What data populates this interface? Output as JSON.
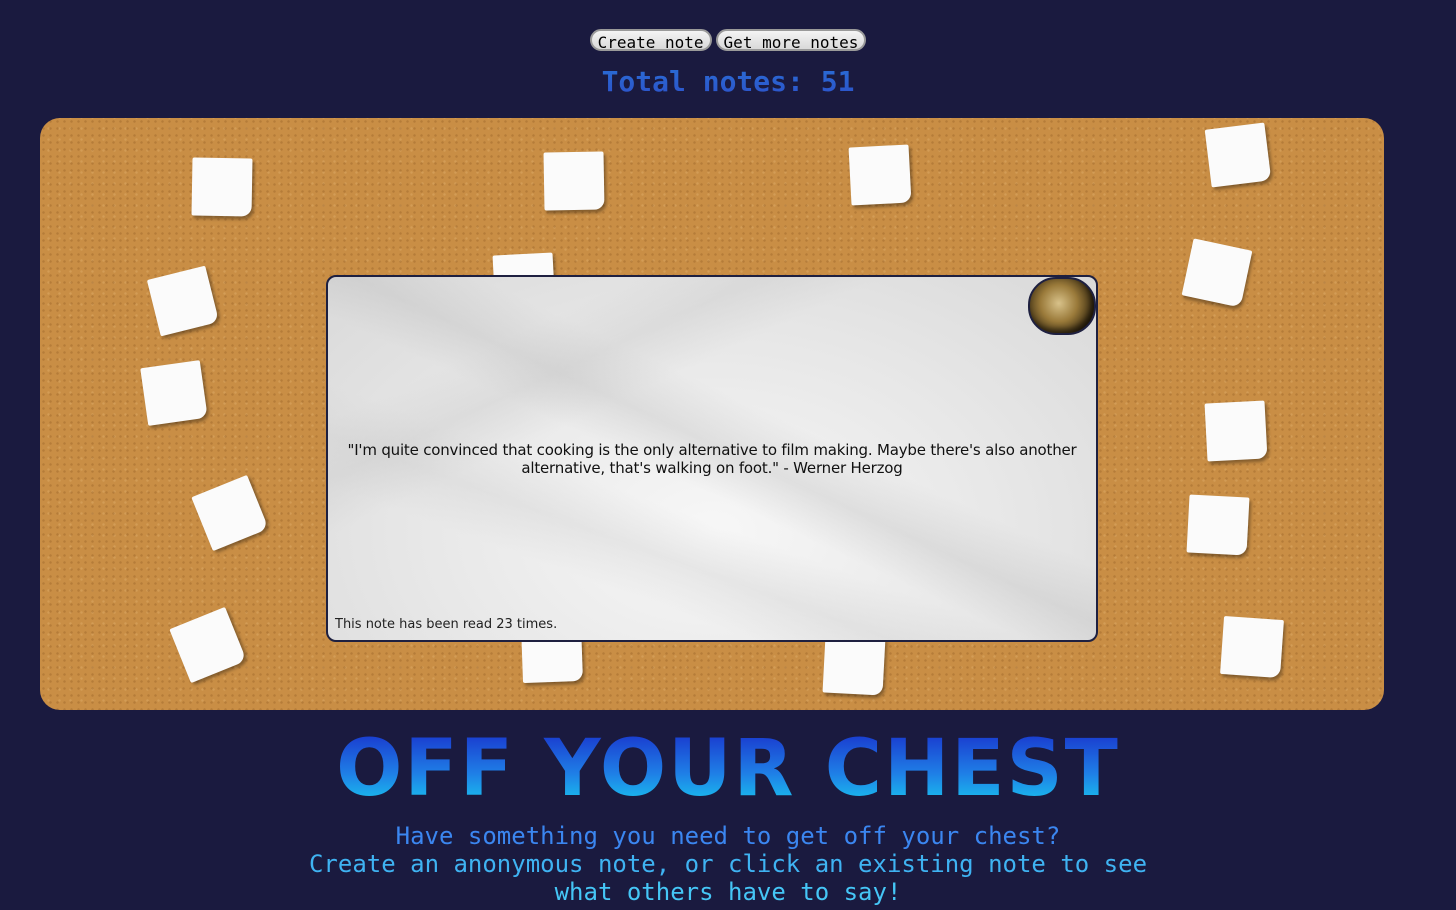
{
  "toolbar": {
    "create_label": "Create note",
    "more_label": "Get more notes"
  },
  "header": {
    "total_notes": "Total notes: 51"
  },
  "modal": {
    "quote": "\"I'm quite convinced that cooking is the only alternative to film making. Maybe there's also another alternative, that's walking on foot.\" - Werner Herzog",
    "read_count": "This note has been read 23 times."
  },
  "footer": {
    "title": "OFF YOUR CHEST",
    "tagline_1": "Have something you need to get off your chest?",
    "tagline_2": "Create an anonymous note, or click an existing note to see",
    "tagline_3": "what others have to say!"
  },
  "colors": {
    "background": "#1a1a3f",
    "board": "#c98e45",
    "accent": "#2c6ad6"
  }
}
